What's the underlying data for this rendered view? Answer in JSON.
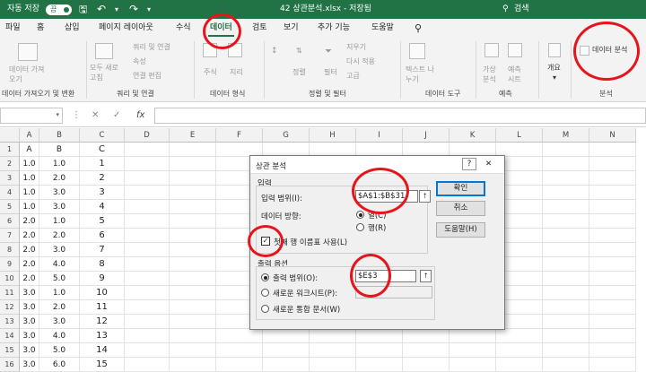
{
  "title_bar": {
    "autosave_label": "자동 저장",
    "autosave_state": "끔",
    "file_title": "42 상관분석.xlsx - 저장됨",
    "search_placeholder": "검색"
  },
  "menu_tabs": [
    "파일",
    "홈",
    "삽입",
    "페이지 레이아웃",
    "수식",
    "데이터",
    "검토",
    "보기",
    "추가 기능",
    "도움말"
  ],
  "ribbon": {
    "get_data": {
      "button": "데이터 가져오기",
      "group": "데이터 가져오기 및 변환"
    },
    "queries": {
      "refresh": "모두 새로 고침",
      "items": [
        "쿼리 및 연결",
        "속성",
        "연결 편집"
      ],
      "group": "쿼리 및 연결"
    },
    "data_types": {
      "items": [
        "주식",
        "지리"
      ],
      "group": "데이터 형식"
    },
    "sort_filter": {
      "sort": "정렬",
      "filter": "필터",
      "items": [
        "지우기",
        "다시 적용",
        "고급"
      ],
      "group": "정렬 및 필터"
    },
    "data_tools": {
      "button": "텍스트 나누기",
      "group": "데이터 도구"
    },
    "forecast": {
      "items": [
        "가상 분석",
        "예측 시트"
      ],
      "group": "예측"
    },
    "outline": {
      "button": "개요"
    },
    "analysis": {
      "button": "데이터 분석",
      "group": "분석"
    }
  },
  "formula_bar": {
    "cancel": "✕",
    "enter": "✓",
    "fx": "fx"
  },
  "columns": [
    "A",
    "B",
    "C",
    "D",
    "E",
    "F",
    "G",
    "H",
    "I",
    "J",
    "K",
    "L",
    "M",
    "N"
  ],
  "rows": [
    {
      "n": "1",
      "a": "A",
      "b": "B",
      "c": "C"
    },
    {
      "n": "2",
      "a": "1.0",
      "b": "1.0",
      "c": "1"
    },
    {
      "n": "3",
      "a": "1.0",
      "b": "2.0",
      "c": "2"
    },
    {
      "n": "4",
      "a": "1.0",
      "b": "3.0",
      "c": "3"
    },
    {
      "n": "5",
      "a": "1.0",
      "b": "3.0",
      "c": "4"
    },
    {
      "n": "6",
      "a": "2.0",
      "b": "1.0",
      "c": "5"
    },
    {
      "n": "7",
      "a": "2.0",
      "b": "2.0",
      "c": "6"
    },
    {
      "n": "8",
      "a": "2.0",
      "b": "3.0",
      "c": "7"
    },
    {
      "n": "9",
      "a": "2.0",
      "b": "4.0",
      "c": "8"
    },
    {
      "n": "10",
      "a": "2.0",
      "b": "5.0",
      "c": "9"
    },
    {
      "n": "11",
      "a": "3.0",
      "b": "1.0",
      "c": "10"
    },
    {
      "n": "12",
      "a": "3.0",
      "b": "2.0",
      "c": "11"
    },
    {
      "n": "13",
      "a": "3.0",
      "b": "3.0",
      "c": "12"
    },
    {
      "n": "14",
      "a": "3.0",
      "b": "4.0",
      "c": "13"
    },
    {
      "n": "15",
      "a": "3.0",
      "b": "5.0",
      "c": "14"
    },
    {
      "n": "16",
      "a": "3.0",
      "b": "6.0",
      "c": "15"
    }
  ],
  "dialog": {
    "title": "상관 분석",
    "help": "?",
    "close": "✕",
    "input_section": "입력",
    "input_range_label": "입력 범위(I):",
    "input_range_value": "$A$1:$B$31",
    "grouped_by_label": "데이터 방향:",
    "grouped_columns": "열(C)",
    "grouped_rows": "행(R)",
    "labels_first_row": "첫째 행 이름표 사용(L)",
    "output_section": "출력 옵션",
    "output_range_label": "출력 범위(O):",
    "output_range_value": "$E$3",
    "new_worksheet_label": "새로운 워크시트(P):",
    "new_workbook_label": "새로운 통합 문서(W)",
    "ok": "확인",
    "cancel": "취소",
    "help_button": "도움말(H)"
  },
  "highlight_color": "#e8141c"
}
